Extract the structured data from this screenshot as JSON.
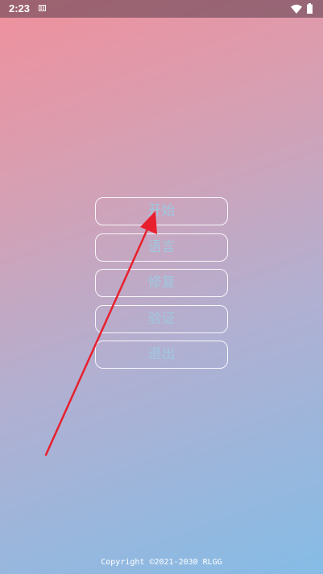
{
  "status_bar": {
    "time": "2:23",
    "icons": [
      "notification-app-icon",
      "wifi-icon",
      "battery-icon"
    ]
  },
  "menu": {
    "buttons": [
      {
        "label": "开始"
      },
      {
        "label": "语言"
      },
      {
        "label": "修复"
      },
      {
        "label": "验证"
      },
      {
        "label": "退出"
      }
    ]
  },
  "footer": {
    "copyright": "Copyright ©2021-2030 RLGG"
  },
  "annotation": {
    "arrow_color": "#e8202e",
    "points_to": "开始"
  },
  "colors": {
    "gradient_top_left": "#f0909c",
    "gradient_bottom_right": "#85bce6",
    "button_text": "#9fc8e0",
    "button_border": "#ffffff"
  }
}
